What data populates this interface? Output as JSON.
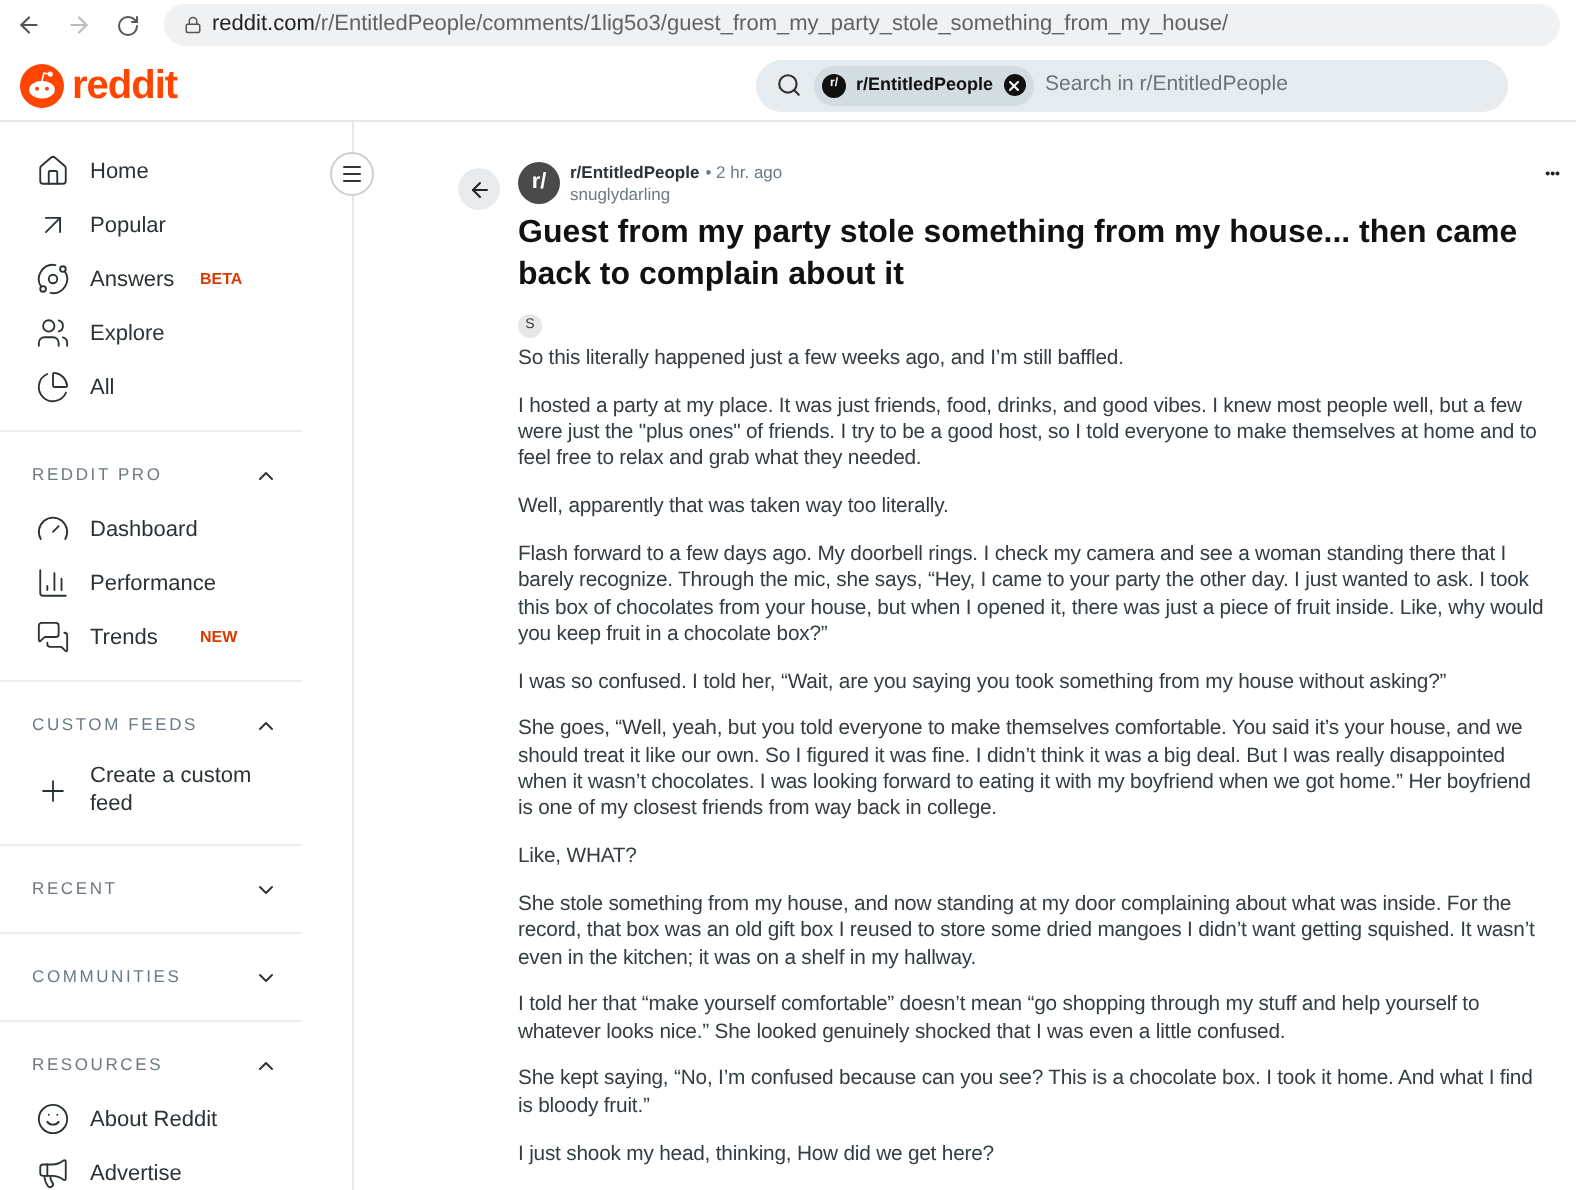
{
  "browser": {
    "url_host": "reddit.com",
    "url_path": "/r/EntitledPeople/comments/1lig5o3/guest_from_my_party_stole_something_from_my_house/"
  },
  "header": {
    "logo": "reddit",
    "search": {
      "chip": "r/EntitledPeople",
      "chip_icon": "r/",
      "placeholder": "Search in r/EntitledPeople"
    }
  },
  "sidebar": {
    "items": [
      {
        "label": "Home"
      },
      {
        "label": "Popular"
      },
      {
        "label": "Answers",
        "badge": "BETA"
      },
      {
        "label": "Explore"
      },
      {
        "label": "All"
      }
    ],
    "sections": [
      {
        "title": "REDDIT PRO",
        "expanded": true,
        "items": [
          {
            "label": "Dashboard"
          },
          {
            "label": "Performance"
          },
          {
            "label": "Trends",
            "badge": "NEW"
          }
        ]
      },
      {
        "title": "CUSTOM FEEDS",
        "expanded": true,
        "items": [
          {
            "label": "Create a custom feed"
          }
        ]
      },
      {
        "title": "RECENT",
        "expanded": false
      },
      {
        "title": "COMMUNITIES",
        "expanded": false
      },
      {
        "title": "RESOURCES",
        "expanded": true,
        "items": [
          {
            "label": "About Reddit"
          },
          {
            "label": "Advertise"
          }
        ]
      }
    ]
  },
  "post": {
    "avatar": "r/",
    "subreddit": "r/EntitledPeople",
    "time": "• 2 hr. ago",
    "author": "snuglydarling",
    "more": "•••",
    "title": "Guest from my party stole something from my house... then came back to complain about it",
    "tag": "S",
    "paragraphs": [
      "So this literally happened just a few weeks ago, and I’m still baffled.",
      "I hosted a party at my place. It was just friends, food, drinks, and good vibes. I knew most people well, but a few were just the \"plus ones\" of friends. I try to be a good host, so I told everyone to make themselves at home and to feel free to relax and grab what they needed.",
      "Well, apparently that was taken way too literally.",
      "Flash forward to a few days ago. My doorbell rings. I check my camera and see a woman standing there that I barely recognize. Through the mic, she says, “Hey, I came to your party the other day. I just wanted to ask. I took this box of chocolates from your house, but when I opened it, there was just a piece of fruit inside. Like, why would you keep fruit in a chocolate box?”",
      "I was so confused. I told her, “Wait, are you saying you took something from my house without asking?”",
      "She goes, “Well, yeah, but you told everyone to make themselves comfortable. You said it’s your house, and we should treat it like our own. So I figured it was fine. I didn’t think it was a big deal. But I was really disappointed when it wasn’t chocolates. I was looking forward to eating it with my boyfriend when we got home.” Her boyfriend is one of my closest friends from way back in college.",
      "Like, WHAT?",
      "She stole something from my house, and now standing at my door complaining about what was inside. For the record, that box was an old gift box I reused to store some dried mangoes I didn’t want getting squished. It wasn’t even in the kitchen; it was on a shelf in my hallway.",
      "I told her that “make yourself comfortable” doesn’t mean “go shopping through my stuff and help yourself to whatever looks nice.” She looked genuinely shocked that I was even a little confused.",
      "She kept saying, “No, I’m confused because can you see? This is a chocolate box. I took it home. And what I find is bloody fruit.”",
      "I just shook my head, thinking, How did we get here?"
    ]
  }
}
